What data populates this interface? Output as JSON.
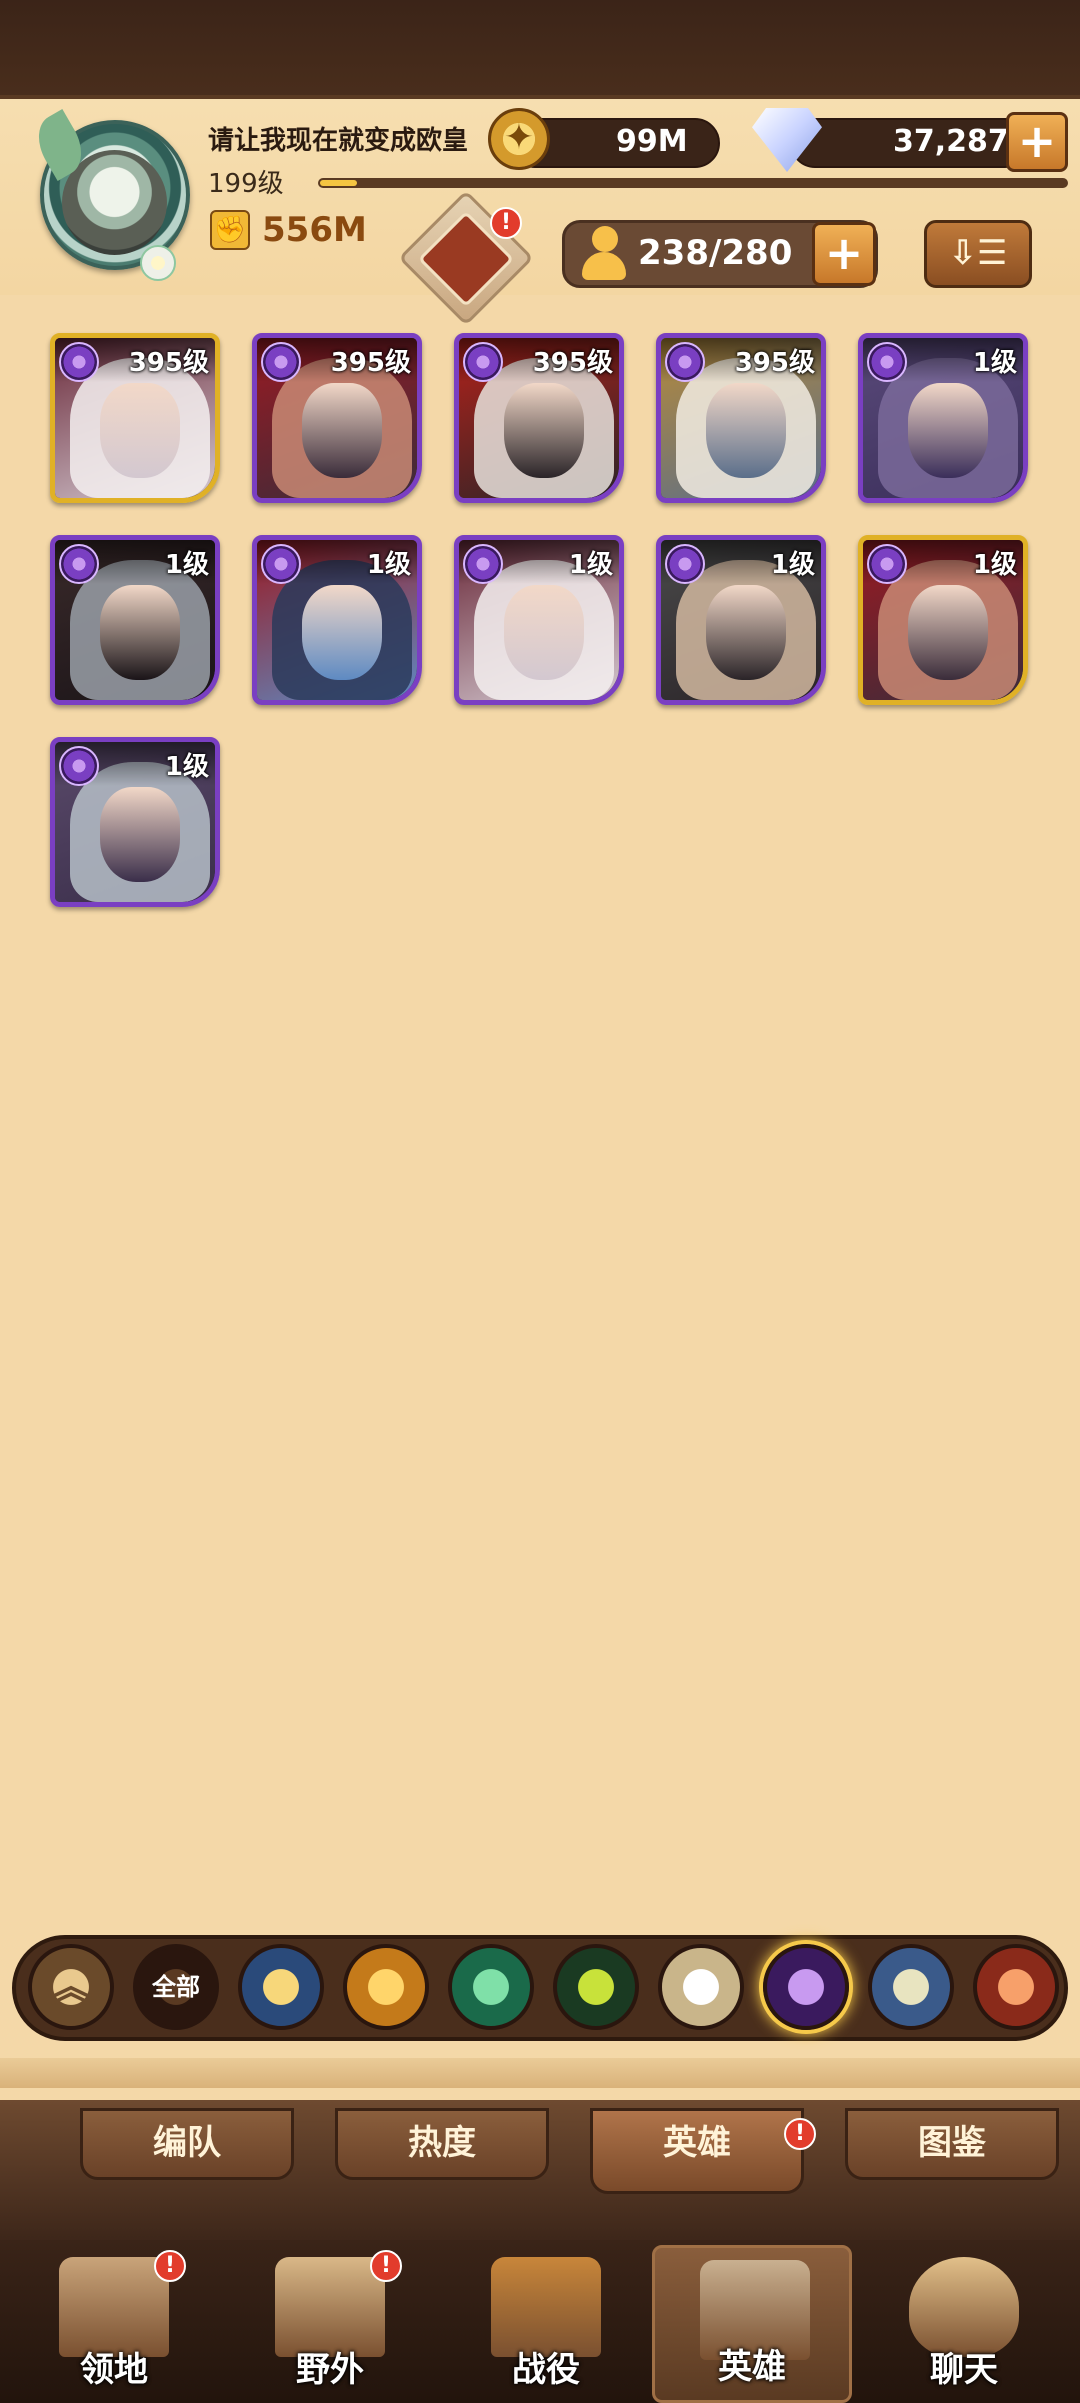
{
  "player": {
    "name": "请让我现在就变成欧皇",
    "level": "199级",
    "xp_fraction": 0.05,
    "power": "556M"
  },
  "resources": {
    "gold": "99M",
    "gems": "37,287",
    "gem_plus": "+",
    "hero_count": "238/280",
    "hero_count_plus": "+"
  },
  "header": {
    "emblem_badge": "!",
    "sort_icon": "⇩☰"
  },
  "heroes": [
    {
      "level": "395级",
      "border": "gold",
      "colors": [
        "#f5f0f0",
        "#d3c8d0",
        "#6b2a3a"
      ]
    },
    {
      "level": "395级",
      "border": "purple",
      "colors": [
        "#c98a74",
        "#3a2c3a",
        "#9a1a22"
      ]
    },
    {
      "level": "395级",
      "border": "purple",
      "colors": [
        "#e8e2dc",
        "#2a2428",
        "#b3221a"
      ]
    },
    {
      "level": "395级",
      "border": "purple",
      "colors": [
        "#f2ece2",
        "#5a6e8a",
        "#b68a3a"
      ]
    },
    {
      "level": "1级",
      "border": "purple",
      "colors": [
        "#7a6a9a",
        "#3a2e5a",
        "#5a4a7a"
      ]
    },
    {
      "level": "1级",
      "border": "purple",
      "colors": [
        "#9aa0a8",
        "#1a1418",
        "#3a2a2a"
      ]
    },
    {
      "level": "1级",
      "border": "purple",
      "colors": [
        "#2a3a5a",
        "#5e8ac2",
        "#9a1a22"
      ]
    },
    {
      "level": "1级",
      "border": "purple",
      "colors": [
        "#f5f0f0",
        "#d3c8d0",
        "#6b2a3a"
      ]
    },
    {
      "level": "1级",
      "border": "purple",
      "colors": [
        "#d2b8a0",
        "#2a2428",
        "#4a4a4a"
      ]
    },
    {
      "level": "1级",
      "border": "gold",
      "colors": [
        "#c98a74",
        "#3a2c3a",
        "#9a1a22"
      ]
    },
    {
      "level": "1级",
      "border": "purple",
      "colors": [
        "#b6c0c8",
        "#3a2e4a",
        "#5a4a6a"
      ]
    }
  ],
  "filters": [
    {
      "label": "",
      "icon": "chevron-up-icon",
      "colors": [
        "#e9c98e",
        "#6a4a2a"
      ]
    },
    {
      "label": "全部",
      "icon": "all-icon",
      "colors": [
        "#5a3a22",
        "#2a160e"
      ]
    },
    {
      "label": "",
      "icon": "lightbearer-icon",
      "colors": [
        "#f7d77a",
        "#2a4a7a"
      ]
    },
    {
      "label": "",
      "icon": "mauler-icon",
      "colors": [
        "#ffd56a",
        "#c47a1a"
      ]
    },
    {
      "label": "",
      "icon": "wilder-icon",
      "colors": [
        "#7fe0a8",
        "#1a6a4a"
      ]
    },
    {
      "label": "",
      "icon": "graveborn-icon",
      "colors": [
        "#c8e23a",
        "#1a3a22"
      ]
    },
    {
      "label": "",
      "icon": "celestial-icon",
      "colors": [
        "#ffffff",
        "#c9b58a"
      ]
    },
    {
      "label": "",
      "icon": "hypogean-icon",
      "colors": [
        "#c89af0",
        "#3a1a5e"
      ]
    },
    {
      "label": "",
      "icon": "dimensional-icon",
      "colors": [
        "#e8e4c0",
        "#3a5a8a"
      ]
    },
    {
      "label": "",
      "icon": "draconis-icon",
      "colors": [
        "#f7a06a",
        "#8a2a1a"
      ]
    }
  ],
  "subtabs": [
    {
      "label": "编队",
      "active": false,
      "badge": ""
    },
    {
      "label": "热度",
      "active": false,
      "badge": ""
    },
    {
      "label": "英雄",
      "active": true,
      "badge": "!"
    },
    {
      "label": "图鉴",
      "active": false,
      "badge": ""
    }
  ],
  "nav": [
    {
      "label": "领地",
      "icon": "castle-icon",
      "badge": "!",
      "active": false
    },
    {
      "label": "野外",
      "icon": "scroll-map-icon",
      "badge": "!",
      "active": false
    },
    {
      "label": "战役",
      "icon": "sword-icon",
      "badge": "",
      "active": false
    },
    {
      "label": "英雄",
      "icon": "helmet-icon",
      "badge": "",
      "active": true
    },
    {
      "label": "聊天",
      "icon": "chat-icon",
      "badge": "",
      "active": false
    }
  ]
}
